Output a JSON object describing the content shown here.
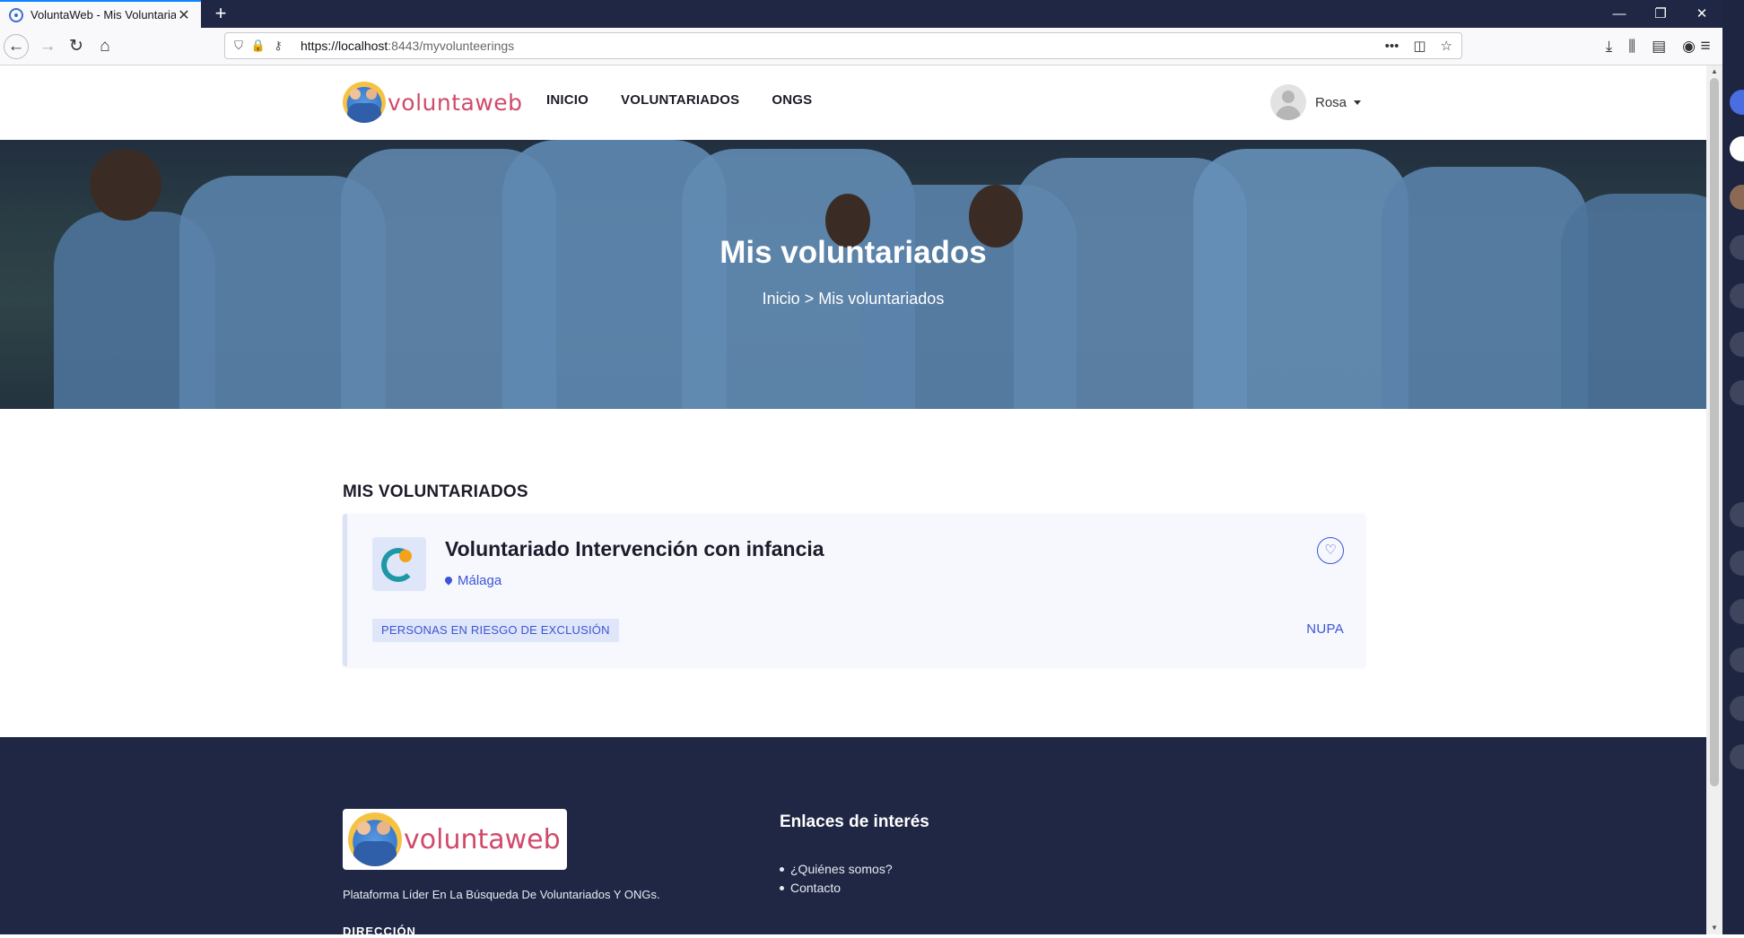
{
  "browser": {
    "tab_title": "VoluntaWeb - Mis Voluntariado",
    "new_tab": "+",
    "url_host": "https://localhost",
    "url_rest": ":8443/myvolunteerings"
  },
  "site": {
    "logo_text": "voluntaweb",
    "nav": [
      "INICIO",
      "VOLUNTARIADOS",
      "ONGS"
    ],
    "user_name": "Rosa"
  },
  "hero": {
    "title": "Mis voluntariados",
    "breadcrumb_home": "Inicio",
    "breadcrumb_sep": ">",
    "breadcrumb_current": "Mis voluntariados"
  },
  "main": {
    "section_title": "MIS VOLUNTARIADOS",
    "volunteerings": [
      {
        "title": "Voluntariado Intervención con infancia",
        "location": "Málaga",
        "category": "PERSONAS EN RIESGO DE EXCLUSIÓN",
        "ong": "NUPA"
      }
    ]
  },
  "footer": {
    "logo_text": "voluntaweb",
    "tagline": "Plataforma Líder En La Búsqueda De Voluntariados Y ONGs.",
    "links_title": "Enlaces de interés",
    "links": [
      "¿Quiénes somos?",
      "Contacto"
    ],
    "address_label": "DIRECCIÓN"
  },
  "colors": {
    "accent": "#3b55d6",
    "dark": "#1f2744",
    "brand_pink": "#d04a6a"
  }
}
